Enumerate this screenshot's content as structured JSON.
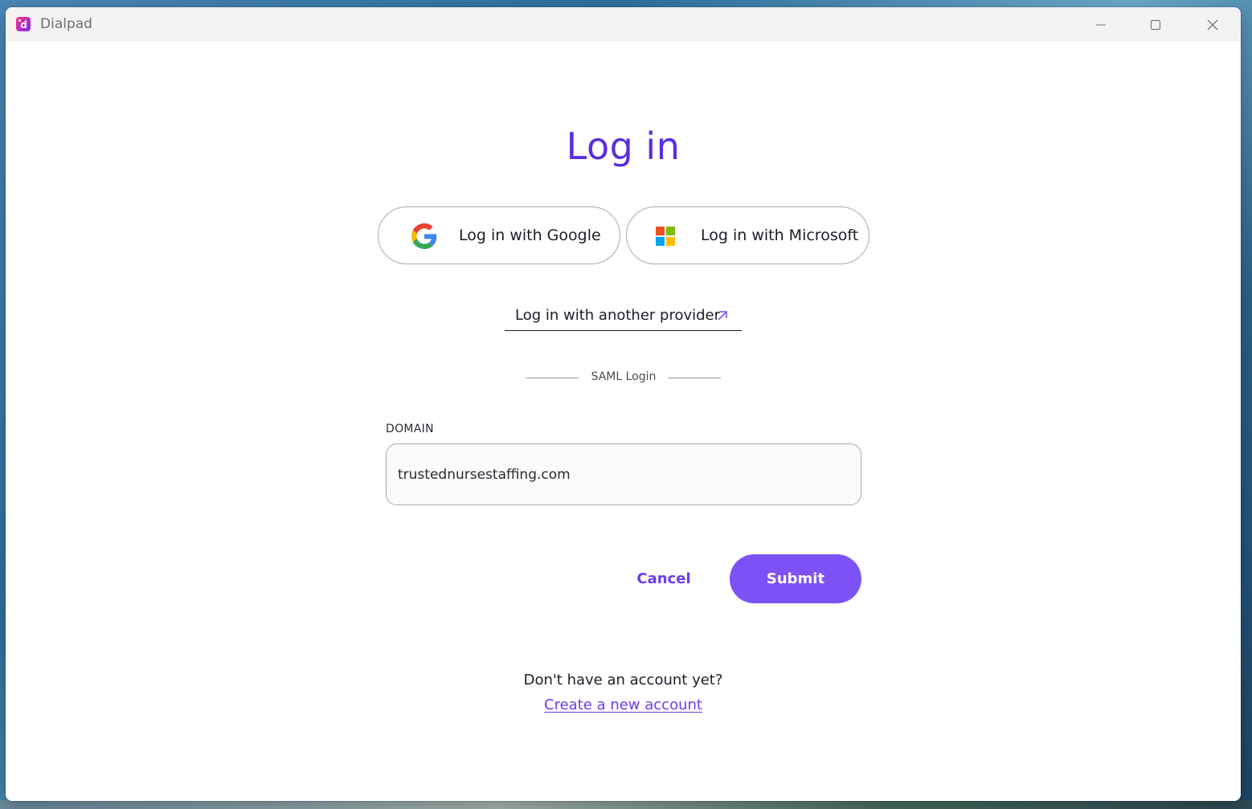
{
  "window": {
    "app_title": "Dialpad"
  },
  "login": {
    "title": "Log in",
    "google_label": "Log in with Google",
    "microsoft_label": "Log in with Microsoft",
    "another_provider_label": "Log in with another provider",
    "divider_label": "SAML Login",
    "domain_label": "DOMAIN",
    "domain_value": "trustednursestaffing.com",
    "cancel_label": "Cancel",
    "submit_label": "Submit",
    "no_account_text": "Don't have an account yet?",
    "create_account_label": "Create a new account"
  },
  "colors": {
    "accent": "#5b2de0",
    "button": "#7c52f6",
    "link": "#6c3cf0"
  },
  "icons": {
    "app": "dialpad-logo-icon",
    "google": "google-logo-icon",
    "microsoft": "microsoft-logo-icon",
    "external": "external-arrow-icon",
    "minimize": "minimize-icon",
    "maximize": "maximize-icon",
    "close": "close-icon"
  }
}
